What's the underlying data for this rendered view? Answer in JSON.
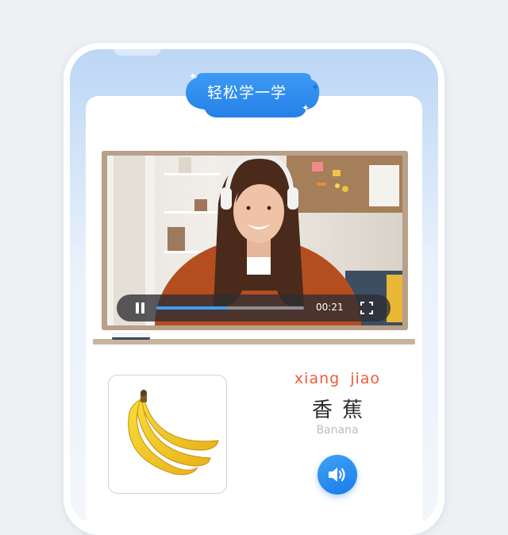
{
  "lesson": {
    "title": "轻松学一学",
    "word": {
      "pinyin": "xiang  jiao",
      "hanzi": "香蕉",
      "english": "Banana"
    }
  },
  "video": {
    "elapsed": "00:21",
    "progress": 0.48,
    "state": "playing"
  },
  "icons": {
    "play_pause": "pause-icon",
    "fullscreen": "fullscreen-icon",
    "audio": "speaker-icon"
  },
  "colors": {
    "accent_blue": "#2f8ef2",
    "pinyin_red": "#f05a3a",
    "progress": "#3a9ef5"
  }
}
